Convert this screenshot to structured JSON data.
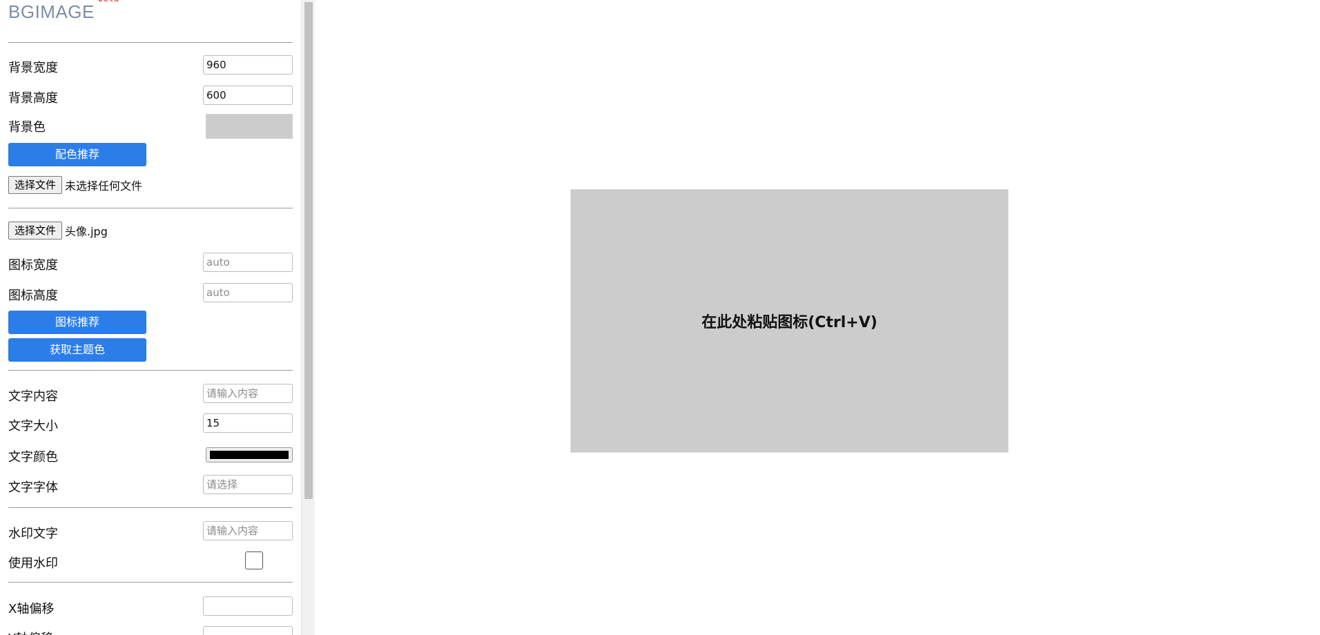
{
  "brand": {
    "name": "BGIMAGE",
    "tag": "beta"
  },
  "background": {
    "width_label": "背景宽度",
    "width_value": "960",
    "height_label": "背景高度",
    "height_value": "600",
    "color_label": "背景色",
    "color_value": "#cccccc",
    "palette_button": "配色推荐",
    "file_button": "选择文件",
    "file_name": "未选择任何文件"
  },
  "icon": {
    "file_button": "选择文件",
    "file_name": "头像.jpg",
    "width_label": "图标宽度",
    "width_placeholder": "auto",
    "height_label": "图标高度",
    "height_placeholder": "auto",
    "recommend_button": "图标推荐",
    "theme_button": "获取主题色"
  },
  "text": {
    "content_label": "文字内容",
    "content_placeholder": "请输入内容",
    "size_label": "文字大小",
    "size_value": "15",
    "color_label": "文字颜色",
    "color_value": "#000000",
    "font_label": "文字字体",
    "font_placeholder": "请选择"
  },
  "watermark": {
    "text_label": "水印文字",
    "text_placeholder": "请输入内容",
    "use_label": "使用水印",
    "use_checked": false
  },
  "offset": {
    "x_label": "X轴偏移",
    "x_value": "",
    "y_label": "Y轴偏移",
    "y_value": ""
  },
  "canvas": {
    "prompt": "在此处粘贴图标(Ctrl+V)"
  }
}
